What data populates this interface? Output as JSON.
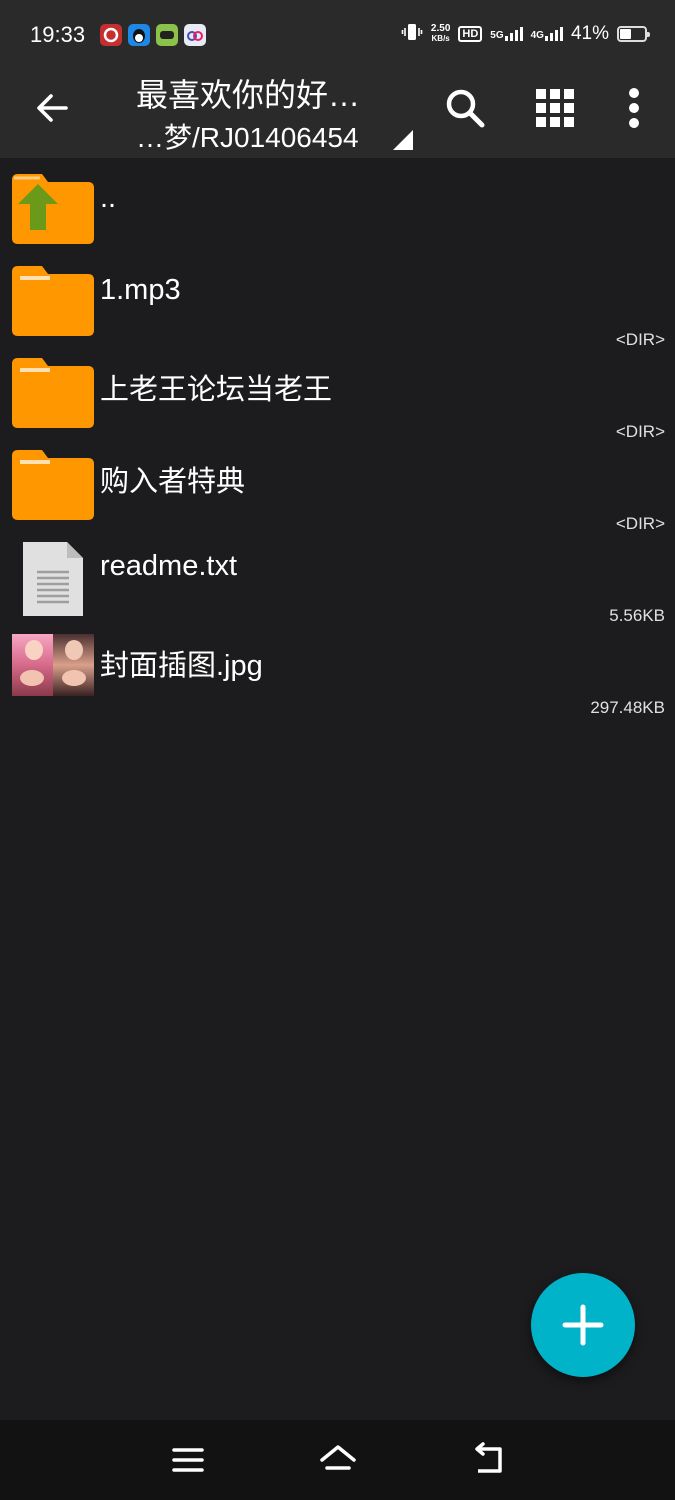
{
  "status_bar": {
    "time": "19:33",
    "notification_icons": [
      {
        "name": "netease-music-icon",
        "color": "#c62f2f"
      },
      {
        "name": "qq-icon",
        "color": "#1e88e5"
      },
      {
        "name": "game-app-icon",
        "color": "#8bc34a"
      },
      {
        "name": "cloud-app-icon",
        "color": "#e8eaf6"
      }
    ],
    "net_speed_value": "2.50",
    "net_speed_unit": "KB/s",
    "hd_label": "HD",
    "sim1_label": "5G",
    "sim2_label": "4G",
    "battery_percent": "41%",
    "battery_level": 0.41
  },
  "toolbar": {
    "title": "最喜欢你的好…",
    "path": "…梦/RJ01406454",
    "icons": [
      "back-arrow-icon",
      "search-icon",
      "grid-view-icon",
      "more-vert-icon"
    ]
  },
  "files": [
    {
      "name": "..",
      "type": "parent",
      "meta": ""
    },
    {
      "name": "1.mp3",
      "type": "folder",
      "meta": "<DIR>"
    },
    {
      "name": "上老王论坛当老王",
      "type": "folder",
      "meta": "<DIR>"
    },
    {
      "name": "购入者特典",
      "type": "folder",
      "meta": "<DIR>"
    },
    {
      "name": "readme.txt",
      "type": "text",
      "meta": "5.56KB"
    },
    {
      "name": "封面插图.jpg",
      "type": "image",
      "meta": "297.48KB"
    }
  ],
  "fab": {
    "icon": "plus-icon",
    "color": "#00b3c9"
  },
  "nav_bar": {
    "icons": [
      "menu-icon",
      "home-icon",
      "back-icon"
    ]
  },
  "colors": {
    "folder": "#ff9800",
    "folder_tab": "#ffb74d",
    "up_arrow": "#6b9a1a",
    "background": "#1c1c1e",
    "toolbar": "#2a2a2a"
  }
}
